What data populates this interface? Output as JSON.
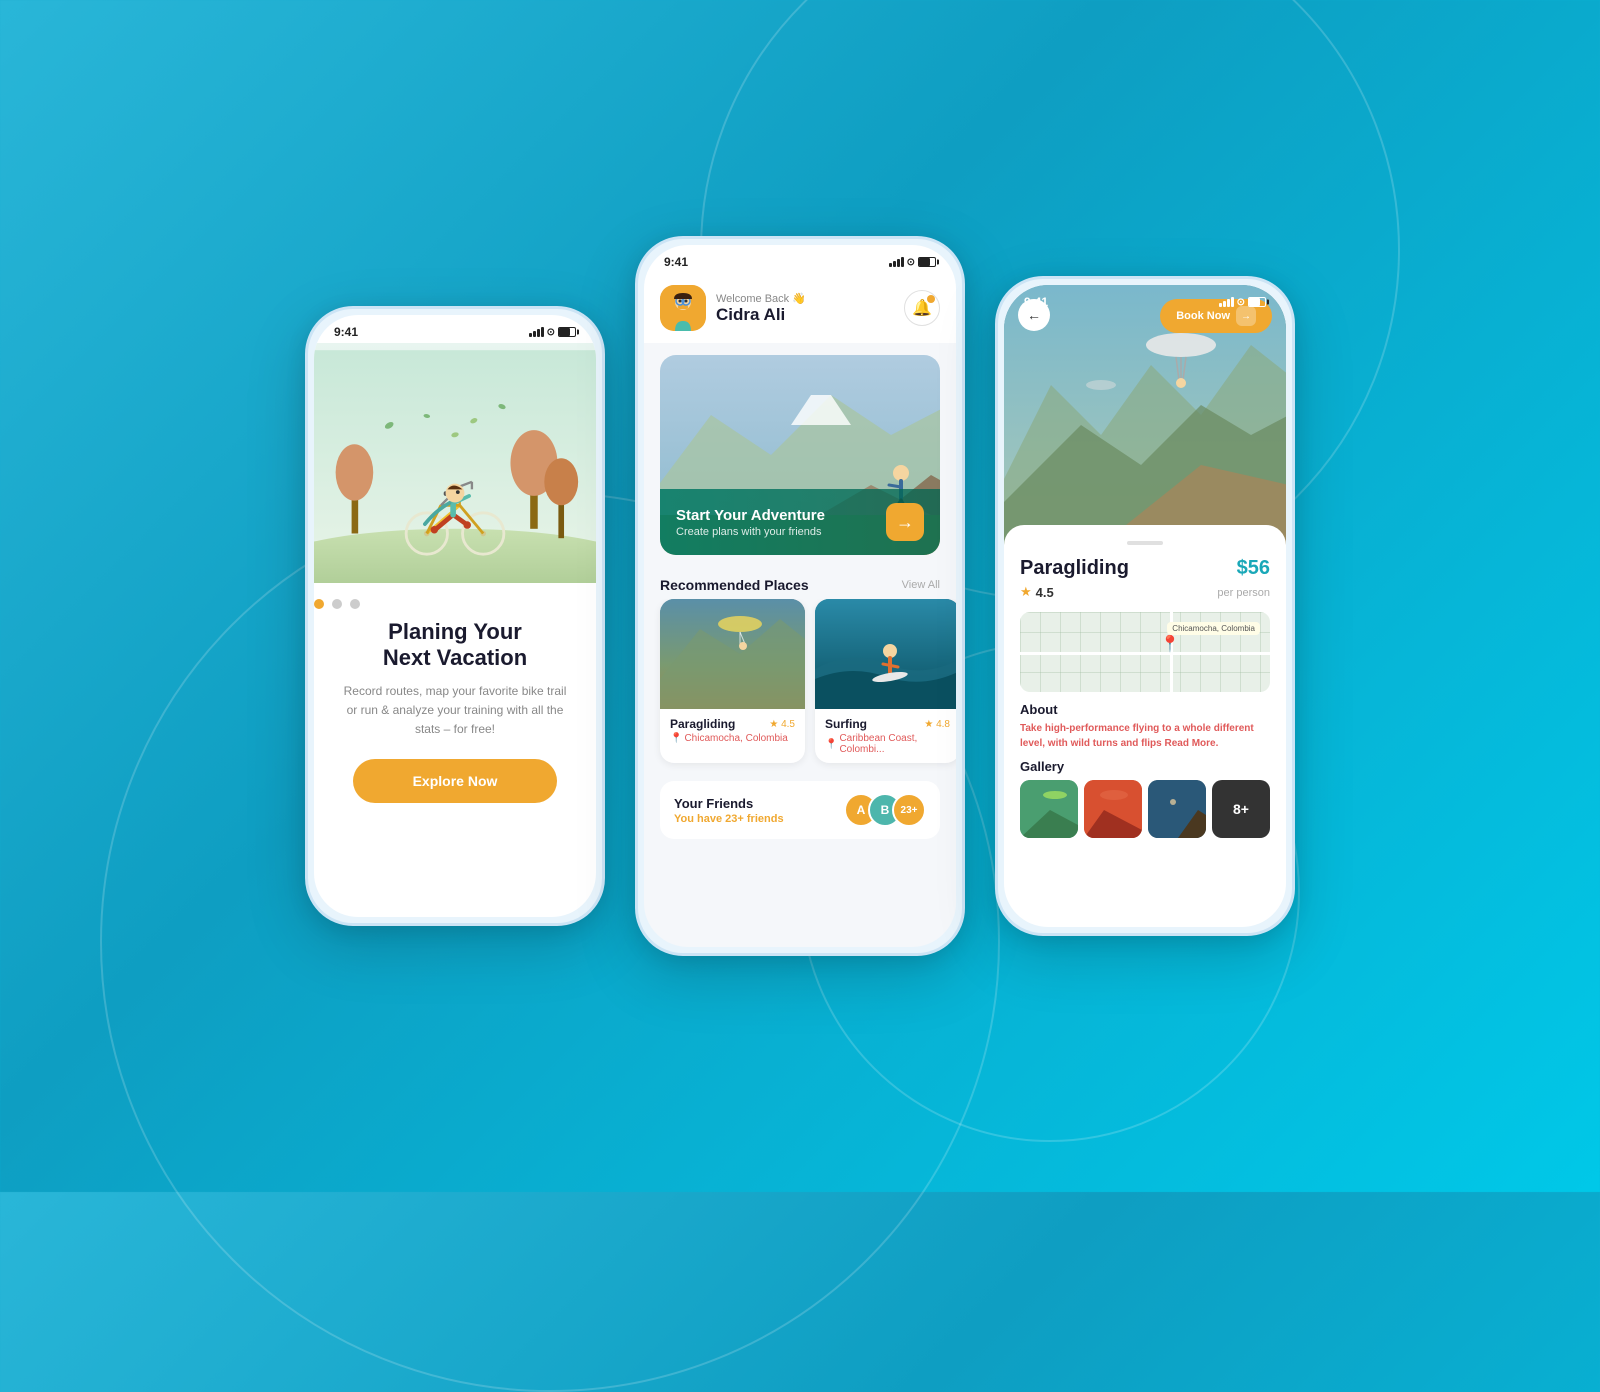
{
  "background": {
    "gradient_start": "#29b6d8",
    "gradient_end": "#00c8e8"
  },
  "phone1": {
    "status_time": "9:41",
    "title_line1": "Planing Your",
    "title_line2": "Next Vacation",
    "description": "Record routes, map your favorite bike trail or run & analyze your training with all the stats – for free!",
    "explore_btn": "Explore Now",
    "dots": [
      "active",
      "inactive",
      "inactive"
    ]
  },
  "phone2": {
    "status_time": "9:41",
    "welcome": "Welcome Back 👋",
    "user_name": "Cidra Ali",
    "hero_title": "Start Your Adventure",
    "hero_sub": "Create plans with your friends",
    "hero_arrow": "→",
    "recommended_label": "Recommended Places",
    "view_all": "View All",
    "places": [
      {
        "name": "Paragliding",
        "rating": "4.5",
        "location": "Chicamocha, Colombia"
      },
      {
        "name": "Surfing",
        "rating": "4.8",
        "location": "Caribbean Coast, Colombi..."
      }
    ],
    "friends_label": "Your Friends",
    "friends_sub_prefix": "You have ",
    "friends_count": "23+",
    "friends_sub_suffix": " friends"
  },
  "phone3": {
    "status_time": "9:41",
    "back_arrow": "←",
    "book_now": "Book Now",
    "book_arrow": "→",
    "activity": "Paragliding",
    "price": "$56",
    "per_person": "per person",
    "rating": "4.5",
    "star": "★",
    "map_location": "Chicamocha, Colombia",
    "about_title": "About",
    "about_text": "Take high-performance flying to a whole different level, with wild turns and flips ",
    "about_read_more": "Read More.",
    "gallery_title": "Gallery",
    "gallery_more": "8+"
  }
}
